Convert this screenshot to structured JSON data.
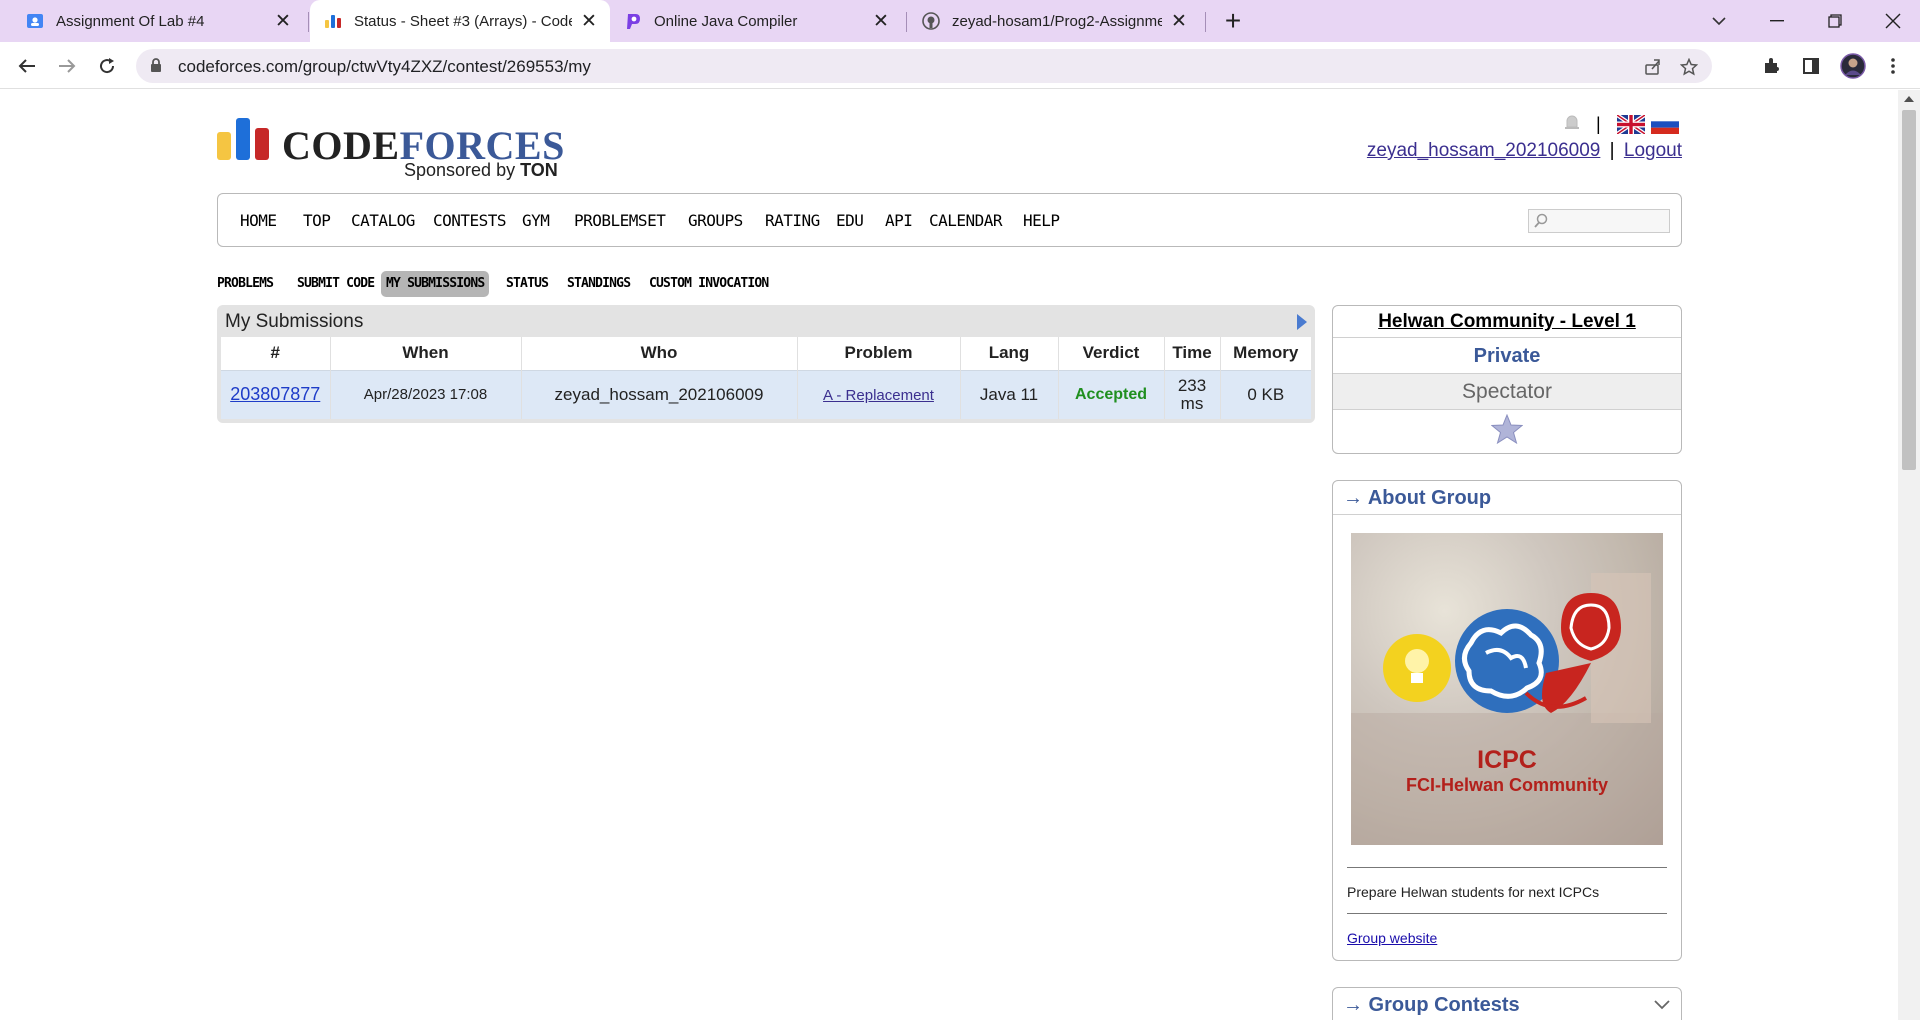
{
  "browser": {
    "tabs": [
      {
        "title": "Assignment Of Lab #4",
        "icon": "google-classroom-icon",
        "active": false
      },
      {
        "title": "Status - Sheet #3 (Arrays) - Code",
        "icon": "codeforces-icon",
        "active": true
      },
      {
        "title": "Online Java Compiler",
        "icon": "programiz-icon",
        "active": false
      },
      {
        "title": "zeyad-hosam1/Prog2-Assignmer",
        "icon": "github-icon",
        "active": false
      }
    ],
    "url": "codeforces.com/group/ctwVty4ZXZ/contest/269553/my"
  },
  "header": {
    "logo_word_1": "CODE",
    "logo_word_2": "FORCES",
    "sponsor_prefix": "Sponsored by ",
    "sponsor_name": "TON",
    "username": "zeyad_hossam_202106009",
    "separator": "|",
    "logout": "Logout"
  },
  "main_menu": [
    "HOME",
    "TOP",
    "CATALOG",
    "CONTESTS",
    "GYM",
    "PROBLEMSET",
    "GROUPS",
    "RATING",
    "EDU",
    "API",
    "CALENDAR",
    "HELP"
  ],
  "second_menu": {
    "items": [
      "PROBLEMS",
      "SUBMIT CODE",
      "MY SUBMISSIONS",
      "STATUS",
      "STANDINGS",
      "CUSTOM INVOCATION"
    ],
    "current": "MY SUBMISSIONS"
  },
  "submissions": {
    "title": "My Submissions",
    "headers": [
      "#",
      "When",
      "Who",
      "Problem",
      "Lang",
      "Verdict",
      "Time",
      "Memory"
    ],
    "rows": [
      {
        "id": "203807877",
        "when": "Apr/28/2023 17:08",
        "who": "zeyad_hossam_202106009",
        "problem": "A - Replacement",
        "lang": "Java 11",
        "verdict": "Accepted",
        "time_value": "233",
        "time_unit": "ms",
        "memory": "0 KB"
      }
    ]
  },
  "group_box": {
    "name": "Helwan Community - Level 1",
    "privacy": "Private",
    "role": "Spectator"
  },
  "about_box": {
    "heading": "→ About Group",
    "image_caption_1": "ICPC",
    "image_caption_2": "FCI-Helwan Community",
    "description": "Prepare Helwan students for next ICPCs",
    "website_link": "Group website"
  },
  "contests_box": {
    "heading": "→ Group Contests"
  },
  "colors": {
    "accent": "#3b5998",
    "verdict_ok": "#1f8f1f",
    "tabbar": "#e8d6f4",
    "logo_yellow": "#f5c542",
    "logo_blue": "#1e6fd9",
    "logo_red": "#c62828"
  }
}
